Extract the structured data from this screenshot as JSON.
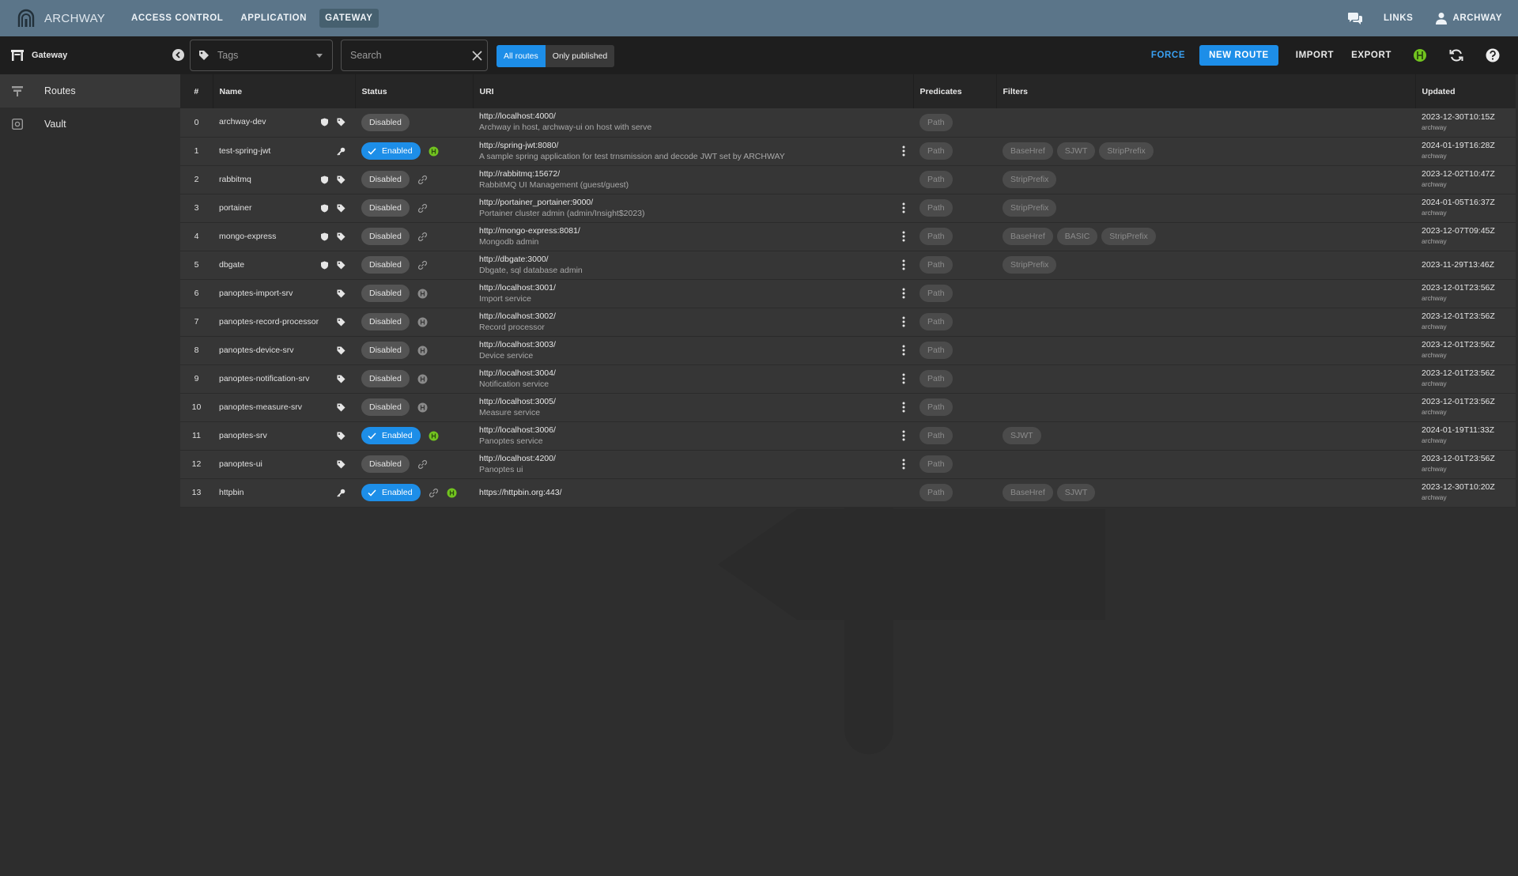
{
  "app": {
    "name": "ARCHWAY"
  },
  "topnav": [
    {
      "label": "ACCESS CONTROL",
      "active": false
    },
    {
      "label": "APPLICATION",
      "active": false
    },
    {
      "label": "GATEWAY",
      "active": true
    }
  ],
  "top_right": {
    "links_label": "LINKS",
    "user_label": "ARCHWAY"
  },
  "sidebar": {
    "title": "Gateway",
    "items": [
      {
        "label": "Routes",
        "active": true
      },
      {
        "label": "Vault",
        "active": false
      }
    ]
  },
  "toolbar": {
    "tags_placeholder": "Tags",
    "search_placeholder": "Search",
    "filter_all": "All routes",
    "filter_published": "Only published",
    "force_label": "FORCE",
    "new_route_label": "NEW ROUTE",
    "import_label": "IMPORT",
    "export_label": "EXPORT"
  },
  "colors": {
    "accent": "#1d8ee8",
    "topbar": "#5b7589",
    "status_ok": "#72c41f"
  },
  "table": {
    "headers": {
      "index": "#",
      "name": "Name",
      "status": "Status",
      "uri": "URI",
      "predicates": "Predicates",
      "filters": "Filters",
      "updated": "Updated"
    },
    "rows": [
      {
        "index": "0",
        "name": "archway-dev",
        "name_icons": [
          "shield-icon",
          "tag-icon"
        ],
        "status": "Disabled",
        "enabled": false,
        "status_icons": [],
        "uri": "http://localhost:4000/",
        "description": "Archway in host, archway-ui on host with serve",
        "menu": false,
        "predicates": [
          "Path"
        ],
        "filters": [],
        "updated": "2023-12-30T10:15Z",
        "updated_by": "archway"
      },
      {
        "index": "1",
        "name": "test-spring-jwt",
        "name_icons": [
          "key-icon"
        ],
        "status": "Enabled",
        "enabled": true,
        "status_icons": [
          "health-ok-icon"
        ],
        "uri": "http://spring-jwt:8080/",
        "description": "A sample spring application for test trnsmission and decode JWT set by ARCHWAY",
        "menu": true,
        "predicates": [
          "Path"
        ],
        "filters": [
          "BaseHref",
          "SJWT",
          "StripPrefix"
        ],
        "updated": "2024-01-19T16:28Z",
        "updated_by": "archway"
      },
      {
        "index": "2",
        "name": "rabbitmq",
        "name_icons": [
          "shield-icon",
          "tag-icon"
        ],
        "status": "Disabled",
        "enabled": false,
        "status_icons": [
          "link-icon"
        ],
        "uri": "http://rabbitmq:15672/",
        "description": "RabbitMQ UI Management (guest/guest)",
        "menu": false,
        "predicates": [
          "Path"
        ],
        "filters": [
          "StripPrefix"
        ],
        "updated": "2023-12-02T10:47Z",
        "updated_by": "archway"
      },
      {
        "index": "3",
        "name": "portainer",
        "name_icons": [
          "shield-icon",
          "tag-icon"
        ],
        "status": "Disabled",
        "enabled": false,
        "status_icons": [
          "link-icon"
        ],
        "uri": "http://portainer_portainer:9000/",
        "description": "Portainer cluster admin (admin/Insight$2023)",
        "menu": true,
        "predicates": [
          "Path"
        ],
        "filters": [
          "StripPrefix"
        ],
        "updated": "2024-01-05T16:37Z",
        "updated_by": "archway"
      },
      {
        "index": "4",
        "name": "mongo-express",
        "name_icons": [
          "shield-icon",
          "tag-icon"
        ],
        "status": "Disabled",
        "enabled": false,
        "status_icons": [
          "link-icon"
        ],
        "uri": "http://mongo-express:8081/",
        "description": "Mongodb admin",
        "menu": true,
        "predicates": [
          "Path"
        ],
        "filters": [
          "BaseHref",
          "BASIC",
          "StripPrefix"
        ],
        "updated": "2023-12-07T09:45Z",
        "updated_by": "archway"
      },
      {
        "index": "5",
        "name": "dbgate",
        "name_icons": [
          "shield-icon",
          "tag-icon"
        ],
        "status": "Disabled",
        "enabled": false,
        "status_icons": [
          "link-icon"
        ],
        "uri": "http://dbgate:3000/",
        "description": "Dbgate, sql database admin",
        "menu": true,
        "predicates": [
          "Path"
        ],
        "filters": [
          "StripPrefix"
        ],
        "updated": "2023-11-29T13:46Z",
        "updated_by": ""
      },
      {
        "index": "6",
        "name": "panoptes-import-srv",
        "name_icons": [
          "tag-icon"
        ],
        "status": "Disabled",
        "enabled": false,
        "status_icons": [
          "health-unknown-icon"
        ],
        "uri": "http://localhost:3001/",
        "description": "Import service",
        "menu": true,
        "predicates": [
          "Path"
        ],
        "filters": [],
        "updated": "2023-12-01T23:56Z",
        "updated_by": "archway"
      },
      {
        "index": "7",
        "name": "panoptes-record-processor",
        "name_icons": [
          "tag-icon"
        ],
        "status": "Disabled",
        "enabled": false,
        "status_icons": [
          "health-unknown-icon"
        ],
        "uri": "http://localhost:3002/",
        "description": "Record processor",
        "menu": true,
        "predicates": [
          "Path"
        ],
        "filters": [],
        "updated": "2023-12-01T23:56Z",
        "updated_by": "archway"
      },
      {
        "index": "8",
        "name": "panoptes-device-srv",
        "name_icons": [
          "tag-icon"
        ],
        "status": "Disabled",
        "enabled": false,
        "status_icons": [
          "health-unknown-icon"
        ],
        "uri": "http://localhost:3003/",
        "description": "Device service",
        "menu": true,
        "predicates": [
          "Path"
        ],
        "filters": [],
        "updated": "2023-12-01T23:56Z",
        "updated_by": "archway"
      },
      {
        "index": "9",
        "name": "panoptes-notification-srv",
        "name_icons": [
          "tag-icon"
        ],
        "status": "Disabled",
        "enabled": false,
        "status_icons": [
          "health-unknown-icon"
        ],
        "uri": "http://localhost:3004/",
        "description": "Notification service",
        "menu": true,
        "predicates": [
          "Path"
        ],
        "filters": [],
        "updated": "2023-12-01T23:56Z",
        "updated_by": "archway"
      },
      {
        "index": "10",
        "name": "panoptes-measure-srv",
        "name_icons": [
          "tag-icon"
        ],
        "status": "Disabled",
        "enabled": false,
        "status_icons": [
          "health-unknown-icon"
        ],
        "uri": "http://localhost:3005/",
        "description": "Measure service",
        "menu": true,
        "predicates": [
          "Path"
        ],
        "filters": [],
        "updated": "2023-12-01T23:56Z",
        "updated_by": "archway"
      },
      {
        "index": "11",
        "name": "panoptes-srv",
        "name_icons": [
          "tag-icon"
        ],
        "status": "Enabled",
        "enabled": true,
        "status_icons": [
          "health-ok-icon"
        ],
        "uri": "http://localhost:3006/",
        "description": "Panoptes service",
        "menu": true,
        "predicates": [
          "Path"
        ],
        "filters": [
          "SJWT"
        ],
        "updated": "2024-01-19T11:33Z",
        "updated_by": "archway"
      },
      {
        "index": "12",
        "name": "panoptes-ui",
        "name_icons": [
          "tag-icon"
        ],
        "status": "Disabled",
        "enabled": false,
        "status_icons": [
          "link-icon"
        ],
        "uri": "http://localhost:4200/",
        "description": "Panoptes ui",
        "menu": true,
        "predicates": [
          "Path"
        ],
        "filters": [],
        "updated": "2023-12-01T23:56Z",
        "updated_by": "archway"
      },
      {
        "index": "13",
        "name": "httpbin",
        "name_icons": [
          "key-icon"
        ],
        "status": "Enabled",
        "enabled": true,
        "status_icons": [
          "link-icon",
          "health-ok-icon"
        ],
        "uri": "https://httpbin.org:443/",
        "description": "",
        "menu": false,
        "predicates": [
          "Path"
        ],
        "filters": [
          "BaseHref",
          "SJWT"
        ],
        "updated": "2023-12-30T10:20Z",
        "updated_by": "archway"
      }
    ]
  }
}
